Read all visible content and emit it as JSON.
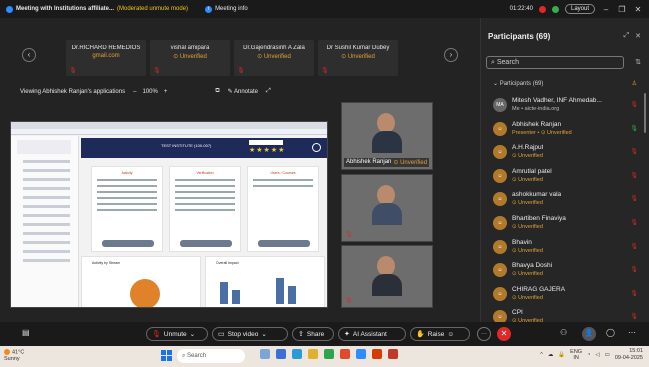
{
  "titlebar": {
    "meeting_title": "Meeting with Institutions affiliate...",
    "moderated": "(Moderated unmute mode)",
    "info_label": "Meeting info",
    "timer": "01:22:40",
    "layout_label": "Layout",
    "minimize": "–",
    "restore": "❐",
    "close": "✕"
  },
  "gallery": {
    "prev": "‹",
    "next": "›",
    "tiles": [
      {
        "name": "Dr.RICHARD REMEDIOS",
        "status": "gmail.com",
        "status_color": "#e3a03b"
      },
      {
        "name": "vishal amipara",
        "status": "⊙ Unverified"
      },
      {
        "name": "Dr.Gajendrasinh A Zala",
        "status": "⊙ Unverified"
      },
      {
        "name": "Dr Sushil Kumar Dubey",
        "status": "⊙ Unverified"
      }
    ]
  },
  "viewbar": {
    "viewing": "Viewing Abhishek Ranjan's applications",
    "minus": "–",
    "zoom": "100%",
    "plus": "+",
    "annotate": "Annotate"
  },
  "shared_screen": {
    "header_text": "TEST INSTITUTE (100-007)",
    "stars": "★★★★★",
    "card_titles": [
      "Activity",
      "Verification",
      "Users / Courses"
    ],
    "bottom_titles": [
      "Activity by Stream",
      "Overall Impact"
    ]
  },
  "cameras": [
    {
      "name": "Abhishek Ranjan",
      "status": "⊙ Unverified",
      "shirt": "#2b3442"
    },
    {
      "name": "",
      "status": "",
      "shirt": "#3f4e66"
    },
    {
      "name": "",
      "status": "",
      "shirt": "#2a2f3a"
    }
  ],
  "participants": {
    "title": "Participants (69)",
    "search_placeholder": "Search",
    "group_label": "Participants (69)",
    "items": [
      {
        "initials": "MA",
        "name": "Mitesh Vadher, INF Ahmedab...",
        "sub": "Me • aicte-india.org",
        "sub_plain": true,
        "avatar": "gray",
        "mic": "muted"
      },
      {
        "initials": "",
        "name": "Abhishek Ranjan",
        "sub": "Presenter • ⊙ Unverified",
        "sub_plain": false,
        "avatar": "orange",
        "mic": "on"
      },
      {
        "initials": "",
        "name": "A.H.Rajput",
        "sub": "⊙ Unverified",
        "sub_plain": false,
        "avatar": "orange",
        "mic": "muted"
      },
      {
        "initials": "",
        "name": "Amrutlal patel",
        "sub": "⊙ Unverified",
        "sub_plain": false,
        "avatar": "orange",
        "mic": "muted"
      },
      {
        "initials": "",
        "name": "ashokkumar vala",
        "sub": "⊙ Unverified",
        "sub_plain": false,
        "avatar": "orange",
        "mic": "muted"
      },
      {
        "initials": "",
        "name": "Bhartiben Finaviya",
        "sub": "⊙ Unverified",
        "sub_plain": false,
        "avatar": "orange",
        "mic": "muted"
      },
      {
        "initials": "",
        "name": "Bhavin",
        "sub": "⊙ Unverified",
        "sub_plain": false,
        "avatar": "orange",
        "mic": "muted"
      },
      {
        "initials": "",
        "name": "Bhavya Doshi",
        "sub": "⊙ Unverified",
        "sub_plain": false,
        "avatar": "orange",
        "mic": "muted"
      },
      {
        "initials": "",
        "name": "CHIRAG GAJERA",
        "sub": "⊙ Unverified",
        "sub_plain": false,
        "avatar": "orange",
        "mic": "muted"
      },
      {
        "initials": "",
        "name": "CPI",
        "sub": "⊙ Unverified",
        "sub_plain": false,
        "avatar": "orange",
        "mic": "muted"
      }
    ]
  },
  "toolbar": {
    "unmute": "Unmute",
    "stop_video": "Stop video",
    "share": "Share",
    "ai_assistant": "AI Assistant",
    "raise": "Raise",
    "more": "···",
    "leave": "✕"
  },
  "taskbar": {
    "temp": "41°C",
    "weather": "Sunny",
    "search": "Search",
    "lang_top": "ENG",
    "lang_bottom": "IN",
    "time": "15:01",
    "date": "09-04-2025"
  }
}
